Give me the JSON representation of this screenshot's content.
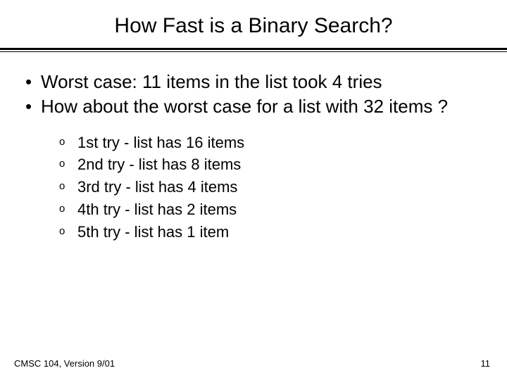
{
  "title": "How Fast is a Binary Search?",
  "bullets": [
    "Worst case: 11 items in the list took 4 tries",
    "How about the worst case for a list with 32 items ?"
  ],
  "sub_bullets": [
    "1st try - list has 16 items",
    "2nd try - list has 8 items",
    "3rd try - list has 4 items",
    "4th try - list has 2 items",
    "5th try - list has 1 item"
  ],
  "footer_left": "CMSC 104, Version 9/01",
  "footer_right": "11"
}
